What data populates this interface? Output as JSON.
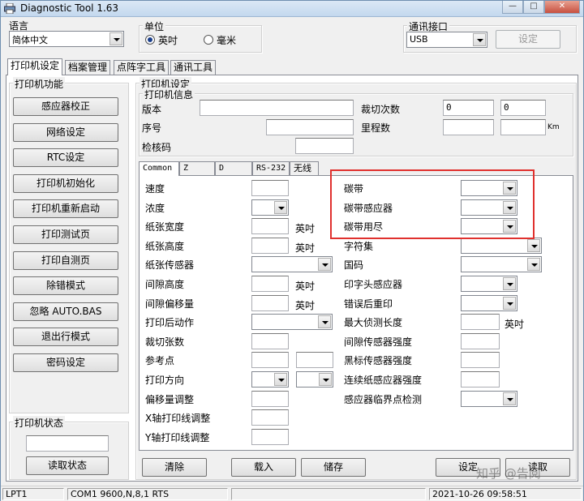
{
  "window": {
    "title": "Diagnostic Tool 1.63",
    "controls": [
      "—",
      "□",
      "✕"
    ]
  },
  "top": {
    "language_label": "语言",
    "language_value": "简体中文",
    "unit_label": "单位",
    "unit_options": [
      {
        "label": "英吋",
        "selected": true
      },
      {
        "label": "毫米",
        "selected": false
      }
    ],
    "comm_label": "通讯接口",
    "comm_value": "USB",
    "setup_button": "设定"
  },
  "tabs": [
    "打印机设定",
    "档案管理",
    "点阵字工具",
    "通讯工具"
  ],
  "left": {
    "function_title": "打印机功能",
    "buttons": [
      "感应器校正",
      "网络设定",
      "RTC设定",
      "打印机初始化",
      "打印机重新启动",
      "打印测试页",
      "打印自测页",
      "除错模式",
      "忽略 AUTO.BAS",
      "退出行模式",
      "密码设定"
    ],
    "status_title": "打印机状态",
    "status_value": "",
    "read_status_button": "读取状态"
  },
  "settings": {
    "title": "打印机设定",
    "info_title": "打印机信息",
    "version_label": "版本",
    "serial_label": "序号",
    "checksum_label": "检核码",
    "cut_count_label": "裁切次数",
    "cut_count_1": "0",
    "cut_count_2": "0",
    "mileage_label": "里程数",
    "km_label": "Km"
  },
  "subtabs": [
    "Common",
    "Z",
    "D",
    "RS-232",
    "无线"
  ],
  "left_params": [
    {
      "label": "速度",
      "type": "text",
      "unit": ""
    },
    {
      "label": "浓度",
      "type": "combo",
      "unit": ""
    },
    {
      "label": "纸张宽度",
      "type": "text",
      "unit": "英吋"
    },
    {
      "label": "纸张高度",
      "type": "text",
      "unit": "英吋"
    },
    {
      "label": "纸张传感器",
      "type": "combo",
      "unit": ""
    },
    {
      "label": "间隙高度",
      "type": "text",
      "unit": "英吋"
    },
    {
      "label": "间隙偏移量",
      "type": "text",
      "unit": "英吋"
    },
    {
      "label": "打印后动作",
      "type": "combo",
      "unit": ""
    },
    {
      "label": "裁切张数",
      "type": "text",
      "unit": ""
    },
    {
      "label": "参考点",
      "type": "text",
      "unit": ""
    },
    {
      "label": "打印方向",
      "type": "combo",
      "unit": ""
    },
    {
      "label": "偏移量调整",
      "type": "text",
      "unit": ""
    },
    {
      "label": "X轴打印线调整",
      "type": "text",
      "unit": ""
    },
    {
      "label": "Y轴打印线调整",
      "type": "text",
      "unit": ""
    }
  ],
  "right_params": [
    {
      "label": "碳带",
      "type": "combo",
      "unit": ""
    },
    {
      "label": "碳带感应器",
      "type": "combo",
      "unit": ""
    },
    {
      "label": "碳带用尽",
      "type": "combo",
      "unit": ""
    },
    {
      "label": "字符集",
      "type": "combo",
      "unit": ""
    },
    {
      "label": "国码",
      "type": "combo",
      "unit": ""
    },
    {
      "label": "印字头感应器",
      "type": "combo",
      "unit": ""
    },
    {
      "label": "错误后重印",
      "type": "combo",
      "unit": ""
    },
    {
      "label": "最大侦测长度",
      "type": "text",
      "unit": "英吋"
    },
    {
      "label": "间隙传感器强度",
      "type": "text",
      "unit": ""
    },
    {
      "label": "黑标传感器强度",
      "type": "text",
      "unit": ""
    },
    {
      "label": "连续纸感应器强度",
      "type": "text",
      "unit": ""
    },
    {
      "label": "感应器临界点检测",
      "type": "combo",
      "unit": ""
    }
  ],
  "bottom_buttons": [
    "清除",
    "载入",
    "储存",
    "设定",
    "读取"
  ],
  "statusbar": {
    "port": "LPT1",
    "comm": "COM1 9600,N,8,1 RTS",
    "datetime": "2021-10-26 09:58:51"
  },
  "watermark": "知乎 @告阅",
  "highlight_color": "#e0312e"
}
